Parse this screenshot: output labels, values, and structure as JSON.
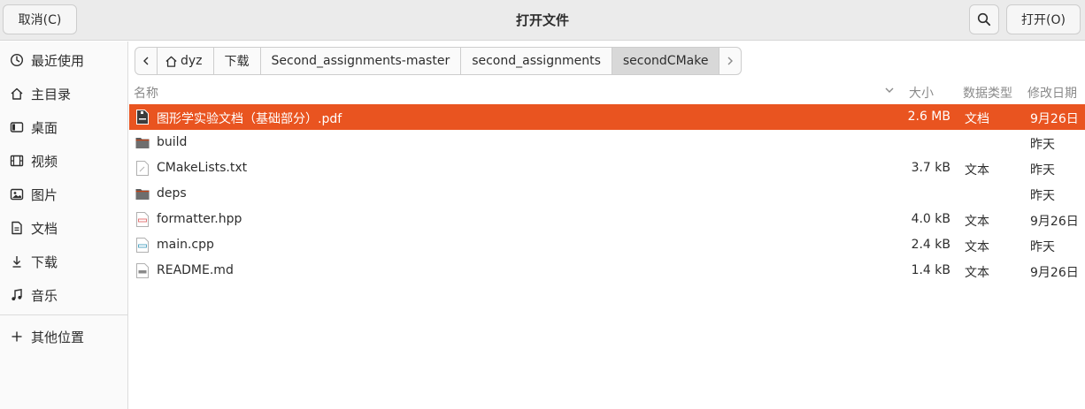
{
  "header": {
    "cancel_label": "取消(C)",
    "title": "打开文件",
    "open_label": "打开(O)"
  },
  "sidebar": {
    "items": [
      {
        "label": "最近使用",
        "icon": "clock-icon"
      },
      {
        "label": "主目录",
        "icon": "home-icon"
      },
      {
        "label": "桌面",
        "icon": "desktop-icon"
      },
      {
        "label": "视频",
        "icon": "film-icon"
      },
      {
        "label": "图片",
        "icon": "image-icon"
      },
      {
        "label": "文档",
        "icon": "document-icon"
      },
      {
        "label": "下载",
        "icon": "download-icon"
      },
      {
        "label": "音乐",
        "icon": "music-icon"
      }
    ],
    "other_locations": "其他位置"
  },
  "pathbar": {
    "crumbs": [
      "dyz",
      "下载",
      "Second_assignments-master",
      "second_assignments",
      "secondCMake"
    ]
  },
  "columns": {
    "name": "名称",
    "size": "大小",
    "type": "数据类型",
    "modified": "修改日期"
  },
  "files": [
    {
      "name": "图形学实验文档（基础部分）.pdf",
      "size": "2.6 MB",
      "type": "文档",
      "modified": "9月26日",
      "icon": "pdf-file-icon",
      "selected": true
    },
    {
      "name": "build",
      "size": "",
      "type": "",
      "modified": "昨天",
      "icon": "folder-icon"
    },
    {
      "name": "CMakeLists.txt",
      "size": "3.7 kB",
      "type": "文本",
      "modified": "昨天",
      "icon": "text-file-icon"
    },
    {
      "name": "deps",
      "size": "",
      "type": "",
      "modified": "昨天",
      "icon": "folder-icon"
    },
    {
      "name": "formatter.hpp",
      "size": "4.0 kB",
      "type": "文本",
      "modified": "9月26日",
      "icon": "header-file-icon"
    },
    {
      "name": "main.cpp",
      "size": "2.4 kB",
      "type": "文本",
      "modified": "昨天",
      "icon": "cpp-file-icon"
    },
    {
      "name": "README.md",
      "size": "1.4 kB",
      "type": "文本",
      "modified": "9月26日",
      "icon": "markdown-file-icon"
    }
  ],
  "colors": {
    "accent": "#e95420",
    "headerbar": "#ebebeb",
    "sidebar": "#fafafa"
  }
}
